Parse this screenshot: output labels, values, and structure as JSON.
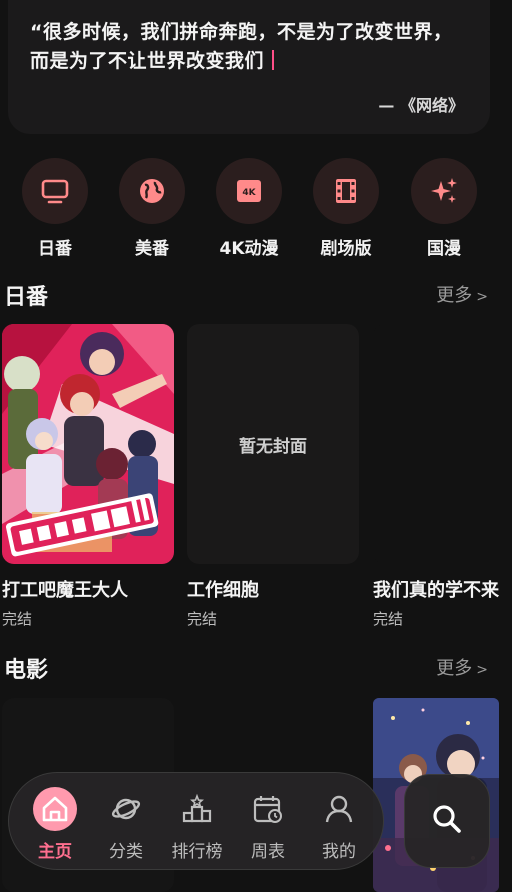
{
  "quote": {
    "text": "“很多时候，我们拼命奔跑，不是为了改变世界，而是为了不让世界改变我们",
    "source": "— 《网络》"
  },
  "categories": [
    {
      "label": "日番",
      "icon": "tv-icon"
    },
    {
      "label": "美番",
      "icon": "globe-icon"
    },
    {
      "label": "4K动漫",
      "icon": "4k-icon"
    },
    {
      "label": "剧场版",
      "icon": "film-icon"
    },
    {
      "label": "国漫",
      "icon": "sparkle-icon"
    }
  ],
  "sections": {
    "japanese": {
      "title": "日番",
      "more": "更多",
      "items": [
        {
          "title": "打工吧魔王大人",
          "status": "完结",
          "cover": "poster-art"
        },
        {
          "title": "工作细胞",
          "status": "完结",
          "cover": "暂无封面"
        },
        {
          "title": "我们真的学不来",
          "status": "完结",
          "cover": "none"
        }
      ]
    },
    "movies": {
      "title": "电影",
      "more": "更多"
    }
  },
  "nav": {
    "items": [
      {
        "label": "主页",
        "icon": "home-icon",
        "active": true
      },
      {
        "label": "分类",
        "icon": "planet-icon",
        "active": false
      },
      {
        "label": "排行榜",
        "icon": "podium-icon",
        "active": false
      },
      {
        "label": "周表",
        "icon": "calendar-icon",
        "active": false
      },
      {
        "label": "我的",
        "icon": "user-icon",
        "active": false
      }
    ],
    "search_icon": "search-icon"
  },
  "colors": {
    "background": "#121212",
    "accent": "#ff6f8f",
    "icon_tint": "#ff8a8a",
    "icon_bg": "#2b1e1e"
  }
}
